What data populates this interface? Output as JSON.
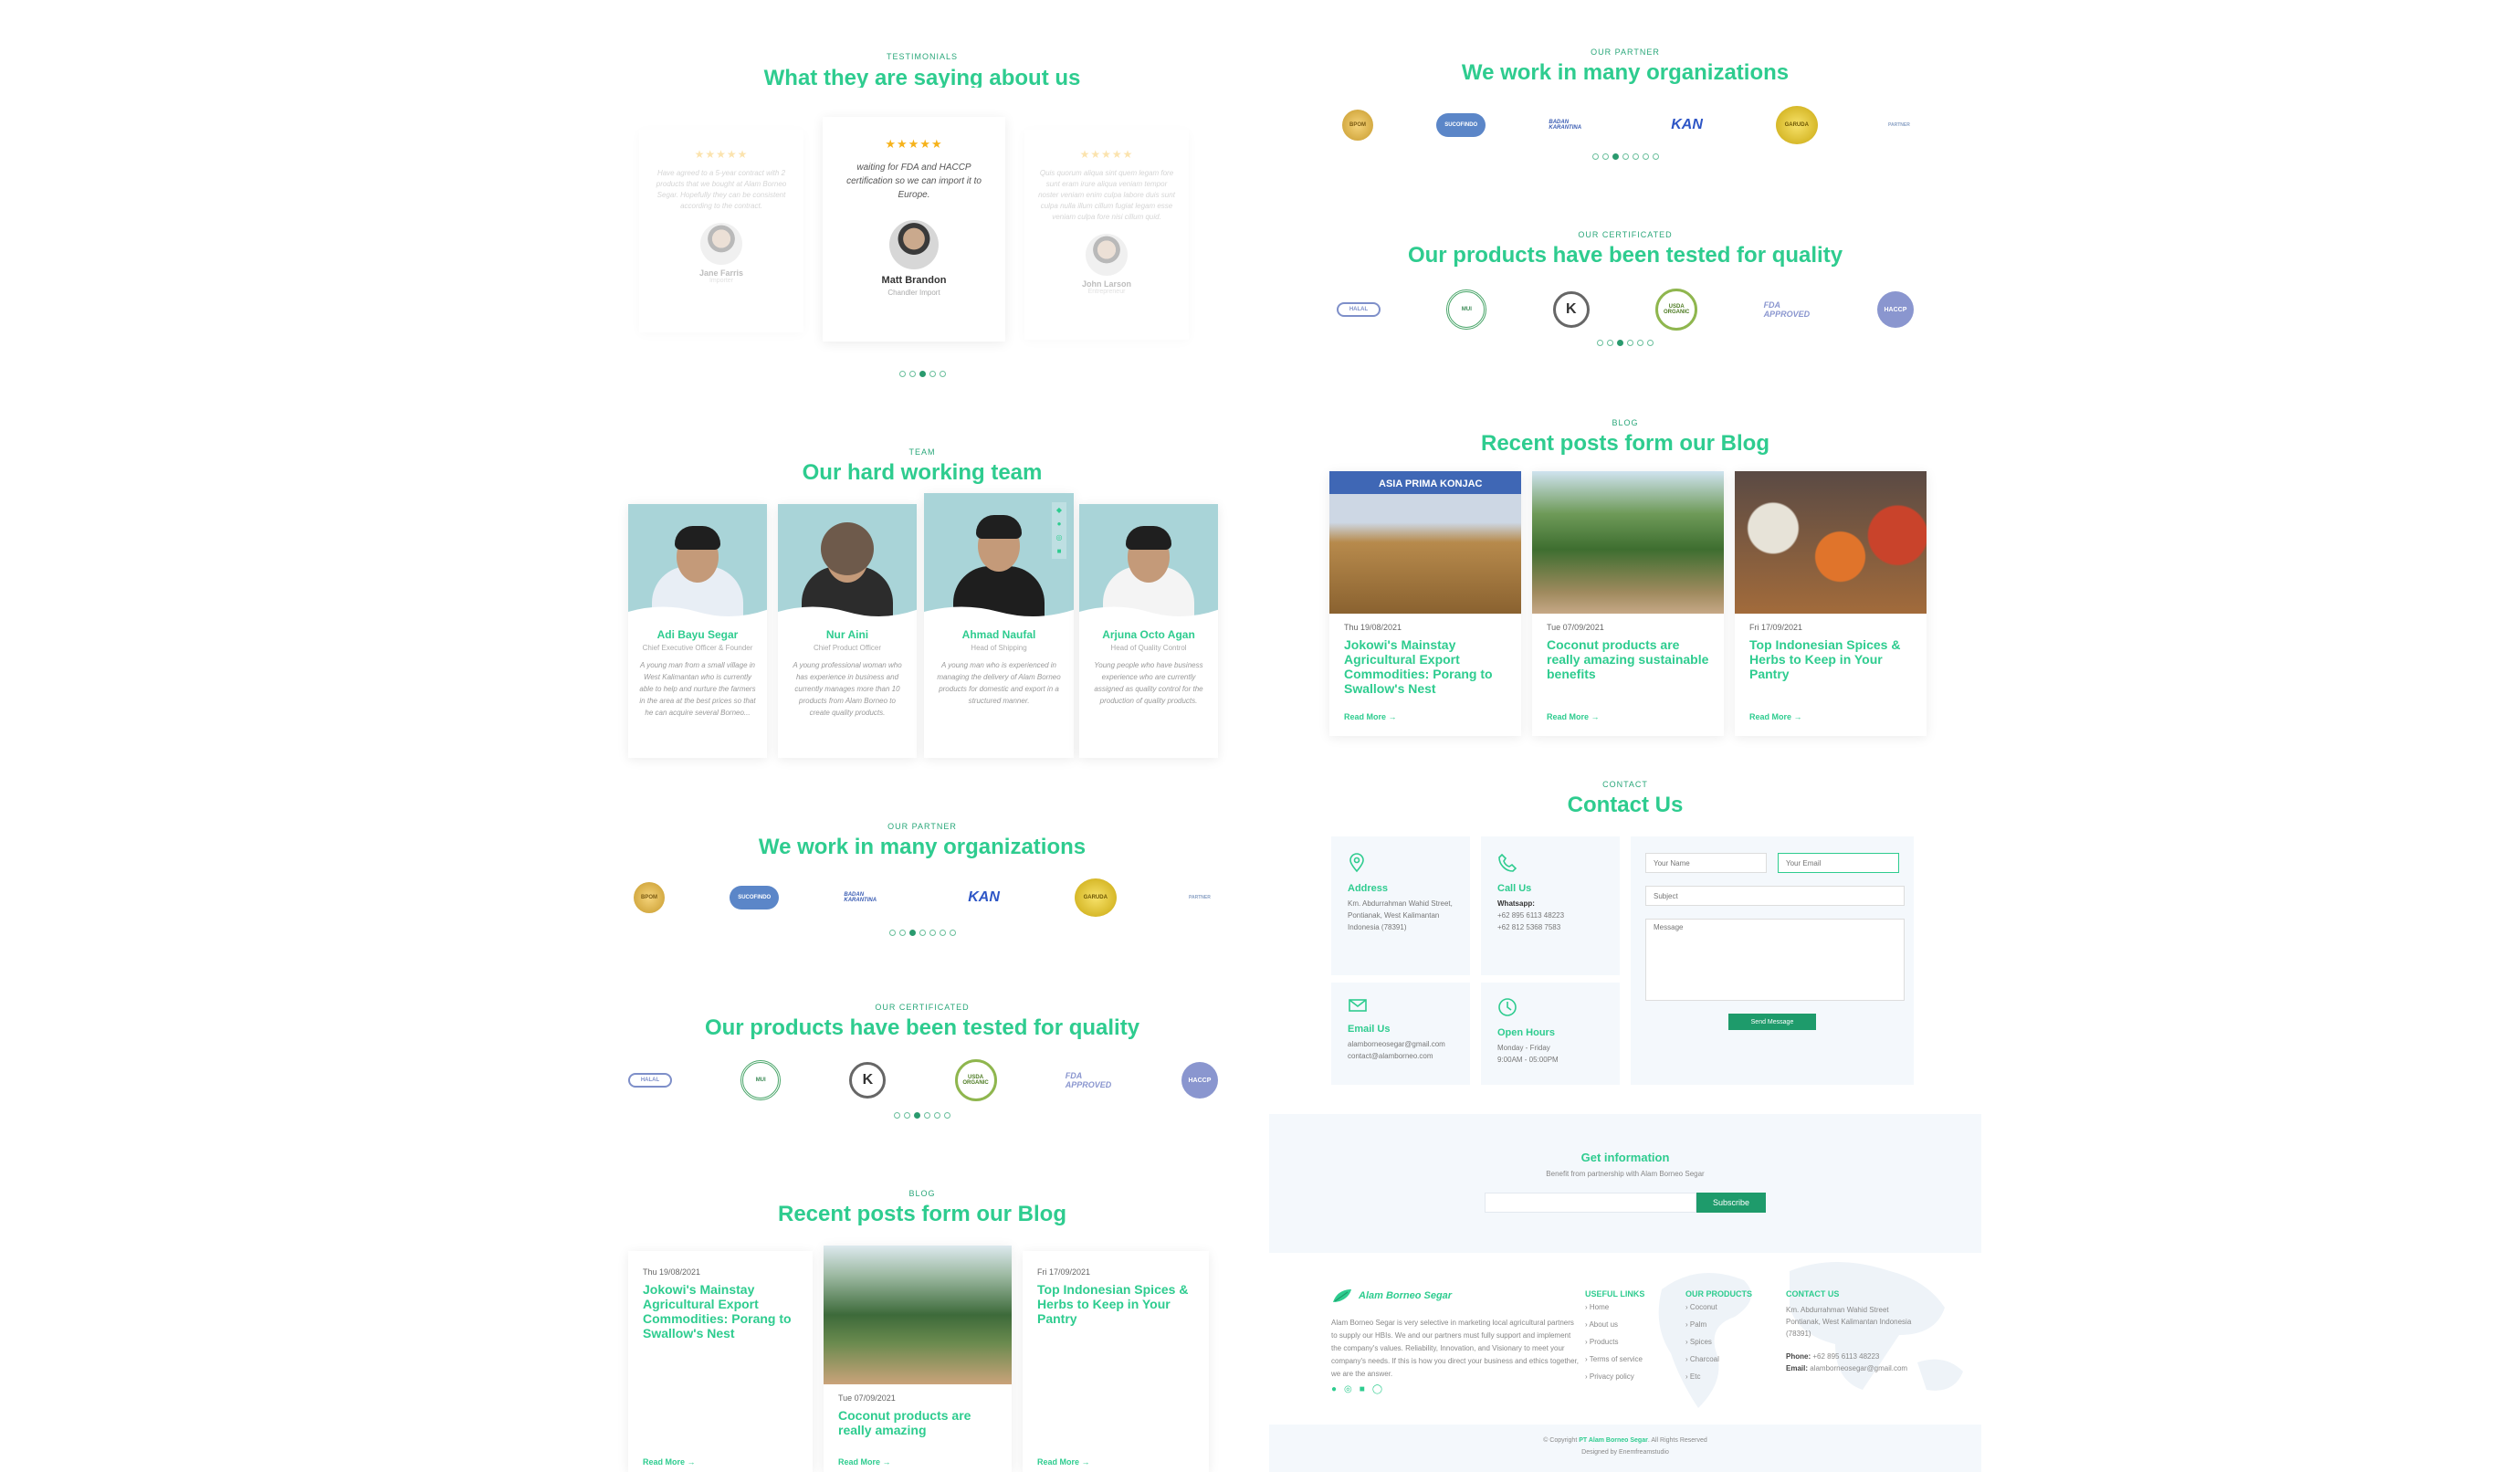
{
  "testimonials": {
    "tag": "TESTIMONIALS",
    "title": "What they are saying about us",
    "items": [
      {
        "text": "Have agreed to a 5-year contract with 2 products that we bought at Alam Borneo Segar. Hopefully they can be consistent according to the contract.",
        "name": "Jane Farris",
        "role": "Importer"
      },
      {
        "text": "waiting for FDA and HACCP certification so we can import it to Europe.",
        "name": "Matt Brandon",
        "role": "Chandler Import"
      },
      {
        "text": "Quis quorum aliqua sint quem legam fore sunt eram irure aliqua veniam tempor noster veniam enim culpa labore duis sunt culpa nulla illum cillum fugiat legam esse veniam culpa fore nisi cillum quid.",
        "name": "John Larson",
        "role": "Entrepreneur"
      }
    ],
    "stars": "★★★★★"
  },
  "team": {
    "tag": "TEAM",
    "title": "Our hard working team",
    "members": [
      {
        "name": "Adi Bayu Segar",
        "role": "Chief Executive Officer & Founder",
        "desc": "A young man from a small village in West Kalimantan who is currently able to help and nurture the farmers in the area at the best prices so that he can acquire several Borneo..."
      },
      {
        "name": "Nur Aini",
        "role": "Chief Product Officer",
        "desc": "A young professional woman who has experience in business and currently manages more than 10 products from Alam Borneo to create quality products."
      },
      {
        "name": "Ahmad Naufal",
        "role": "Head of Shipping",
        "desc": "A young man who is experienced in managing the delivery of Alam Borneo products for domestic and export in a structured manner."
      },
      {
        "name": "Arjuna Octo Agan",
        "role": "Head of Quality Control",
        "desc": "Young people who have business experience who are currently assigned as quality control for the production of quality products."
      }
    ]
  },
  "partners": {
    "tag": "OUR PARTNER",
    "title": "We work in many organizations",
    "logos": [
      "BPOM",
      "SUCOFINDO",
      "BADAN KARANTINA",
      "KAN",
      "GARUDA",
      "PARTNER"
    ]
  },
  "certificates": {
    "tag": "OUR CERTIFICATED",
    "title": "Our products have been tested for quality",
    "logos": [
      "HALAL",
      "MUI",
      "K",
      "USDA ORGANIC",
      "FDA APPROVED",
      "HACCP"
    ]
  },
  "blog": {
    "tag": "BLOG",
    "title": "Recent posts form our Blog",
    "read_more": "Read More →",
    "posts": [
      {
        "date": "Thu 19/08/2021",
        "title": "Jokowi's Mainstay Agricultural Export Commodities: Porang to Swallow's Nest",
        "img": "ASIA PRIMA KONJAC"
      },
      {
        "date": "Tue 07/09/2021",
        "title": "Coconut products are really amazing sustainable benefits"
      },
      {
        "date": "Fri 17/09/2021",
        "title": "Top Indonesian Spices & Herbs to Keep in Your Pantry"
      }
    ]
  },
  "contact": {
    "tag": "CONTACT",
    "title": "Contact Us",
    "address_title": "Address",
    "address": "Km. Abdurrahman Wahid Street, Pontianak, West Kalimantan Indonesia (78391)",
    "call_title": "Call Us",
    "call_label": "Whatsapp:",
    "phone1": "+62 895 6113 48223",
    "phone2": "+62 812 5368 7583",
    "email_title": "Email Us",
    "email1": "alamborneosegar@gmail.com",
    "email2": "contact@alamborneo.com",
    "hours_title": "Open Hours",
    "hours1": "Monday - Friday",
    "hours2": "9:00AM - 05:00PM",
    "name_placeholder": "Your Name",
    "email_placeholder": "Your Email",
    "subject_placeholder": "Subject",
    "message_placeholder": "Message",
    "send_label": "Send Message"
  },
  "newsletter": {
    "title": "Get information",
    "subtitle": "Benefit from partnership with Alam Borneo Segar",
    "button": "Subscribe"
  },
  "footer": {
    "brand": "Alam Borneo Segar",
    "about": "Alam Borneo Segar is very selective in marketing local agricultural partners to supply our HBIs. We and our partners must fully support and implement the company's values. Reliability, Innovation, and Visionary to meet your company's needs. If this is how you direct your business and ethics together, we are the answer.",
    "links_title": "USEFUL LINKS",
    "links": [
      "› Home",
      "› About us",
      "› Products",
      "› Terms of service",
      "› Privacy policy"
    ],
    "products_title": "OUR PRODUCTS",
    "products": [
      "› Coconut",
      "› Palm",
      "› Spices",
      "› Charcoal",
      "› Etc"
    ],
    "contact_title": "CONTACT US",
    "contact_address": "Km. Abdurrahman Wahid Street Pontianak, West Kalimantan Indonesia (78391)",
    "phone_label": "Phone:",
    "phone": "+62 895 6113 48223",
    "email_label": "Email:",
    "email": "alamborneosegar@gmail.com",
    "copyright_prefix": "© Copyright",
    "copyright_brand": "PT Alam Borneo Segar",
    "copyright_suffix": ". All Rights Reserved",
    "designed": "Designed by Enemfreamstudio"
  },
  "colors": {
    "accent": "#2ecc8f",
    "button": "#1e9b6b",
    "panel": "#f4f8fc"
  }
}
